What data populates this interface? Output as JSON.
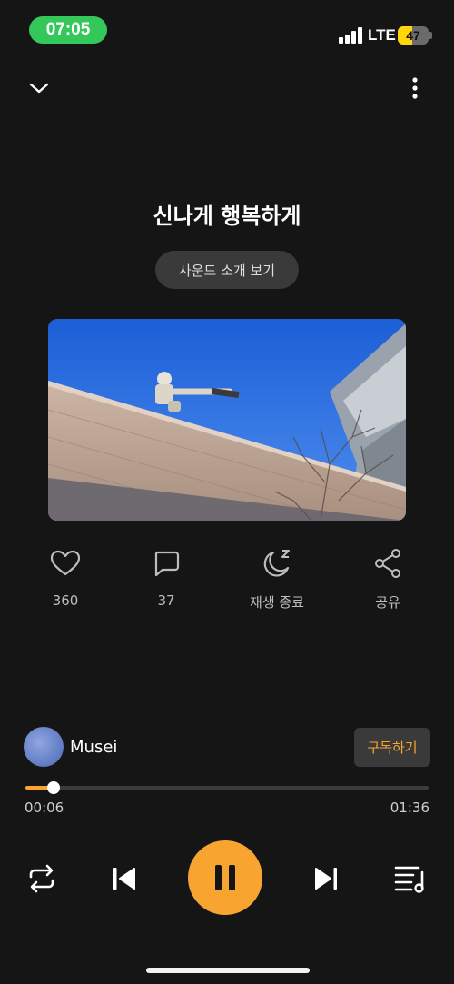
{
  "status": {
    "time": "07:05",
    "network": "LTE",
    "battery": "47",
    "battery_level": 0.47
  },
  "track": {
    "title": "신나게 행복하게",
    "intro_button": "사운드 소개 보기"
  },
  "actions": {
    "like_count": "360",
    "comment_count": "37",
    "sleep_timer_label": "재생 종료",
    "share_label": "공유"
  },
  "artist": {
    "name": "Musei",
    "subscribe_label": "구독하기"
  },
  "playback": {
    "current_time": "00:06",
    "total_time": "01:36",
    "progress": 0.07
  },
  "colors": {
    "accent": "#f7a530",
    "background": "#151515",
    "status_green": "#34c759"
  },
  "icons": {
    "top": [
      "chevron-down-icon",
      "more-vertical-icon"
    ],
    "actions": [
      "heart-icon",
      "comment-icon",
      "moon-sleep-icon",
      "share-icon"
    ],
    "controls": [
      "repeat-icon",
      "skip-previous-icon",
      "pause-icon",
      "skip-next-icon",
      "playlist-icon"
    ]
  }
}
